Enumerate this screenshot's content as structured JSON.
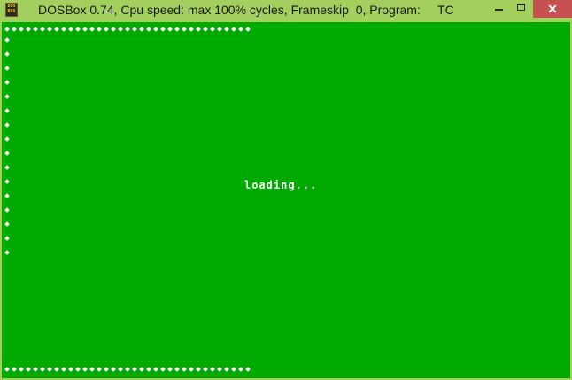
{
  "window": {
    "title": "DOSBox 0.74, Cpu speed: max 100% cycles, Frameskip  0, Program:     TC",
    "icon": "dosbox-icon",
    "icon_text": [
      "DOS",
      "BOX"
    ],
    "controls": {
      "minimize_icon": "minimize-icon",
      "maximize_icon": "maximize-icon",
      "close_icon": "close-icon",
      "close_glyph": "✕"
    }
  },
  "screen": {
    "background_color": "#00aa00",
    "border_glyph": "diamond",
    "top_row_count": 35,
    "bottom_row_count": 35,
    "left_column_count": 16,
    "message": "loading..."
  },
  "colors": {
    "frame": "#a3cf5f",
    "close_button": "#c75050",
    "text": "#ffffff"
  }
}
